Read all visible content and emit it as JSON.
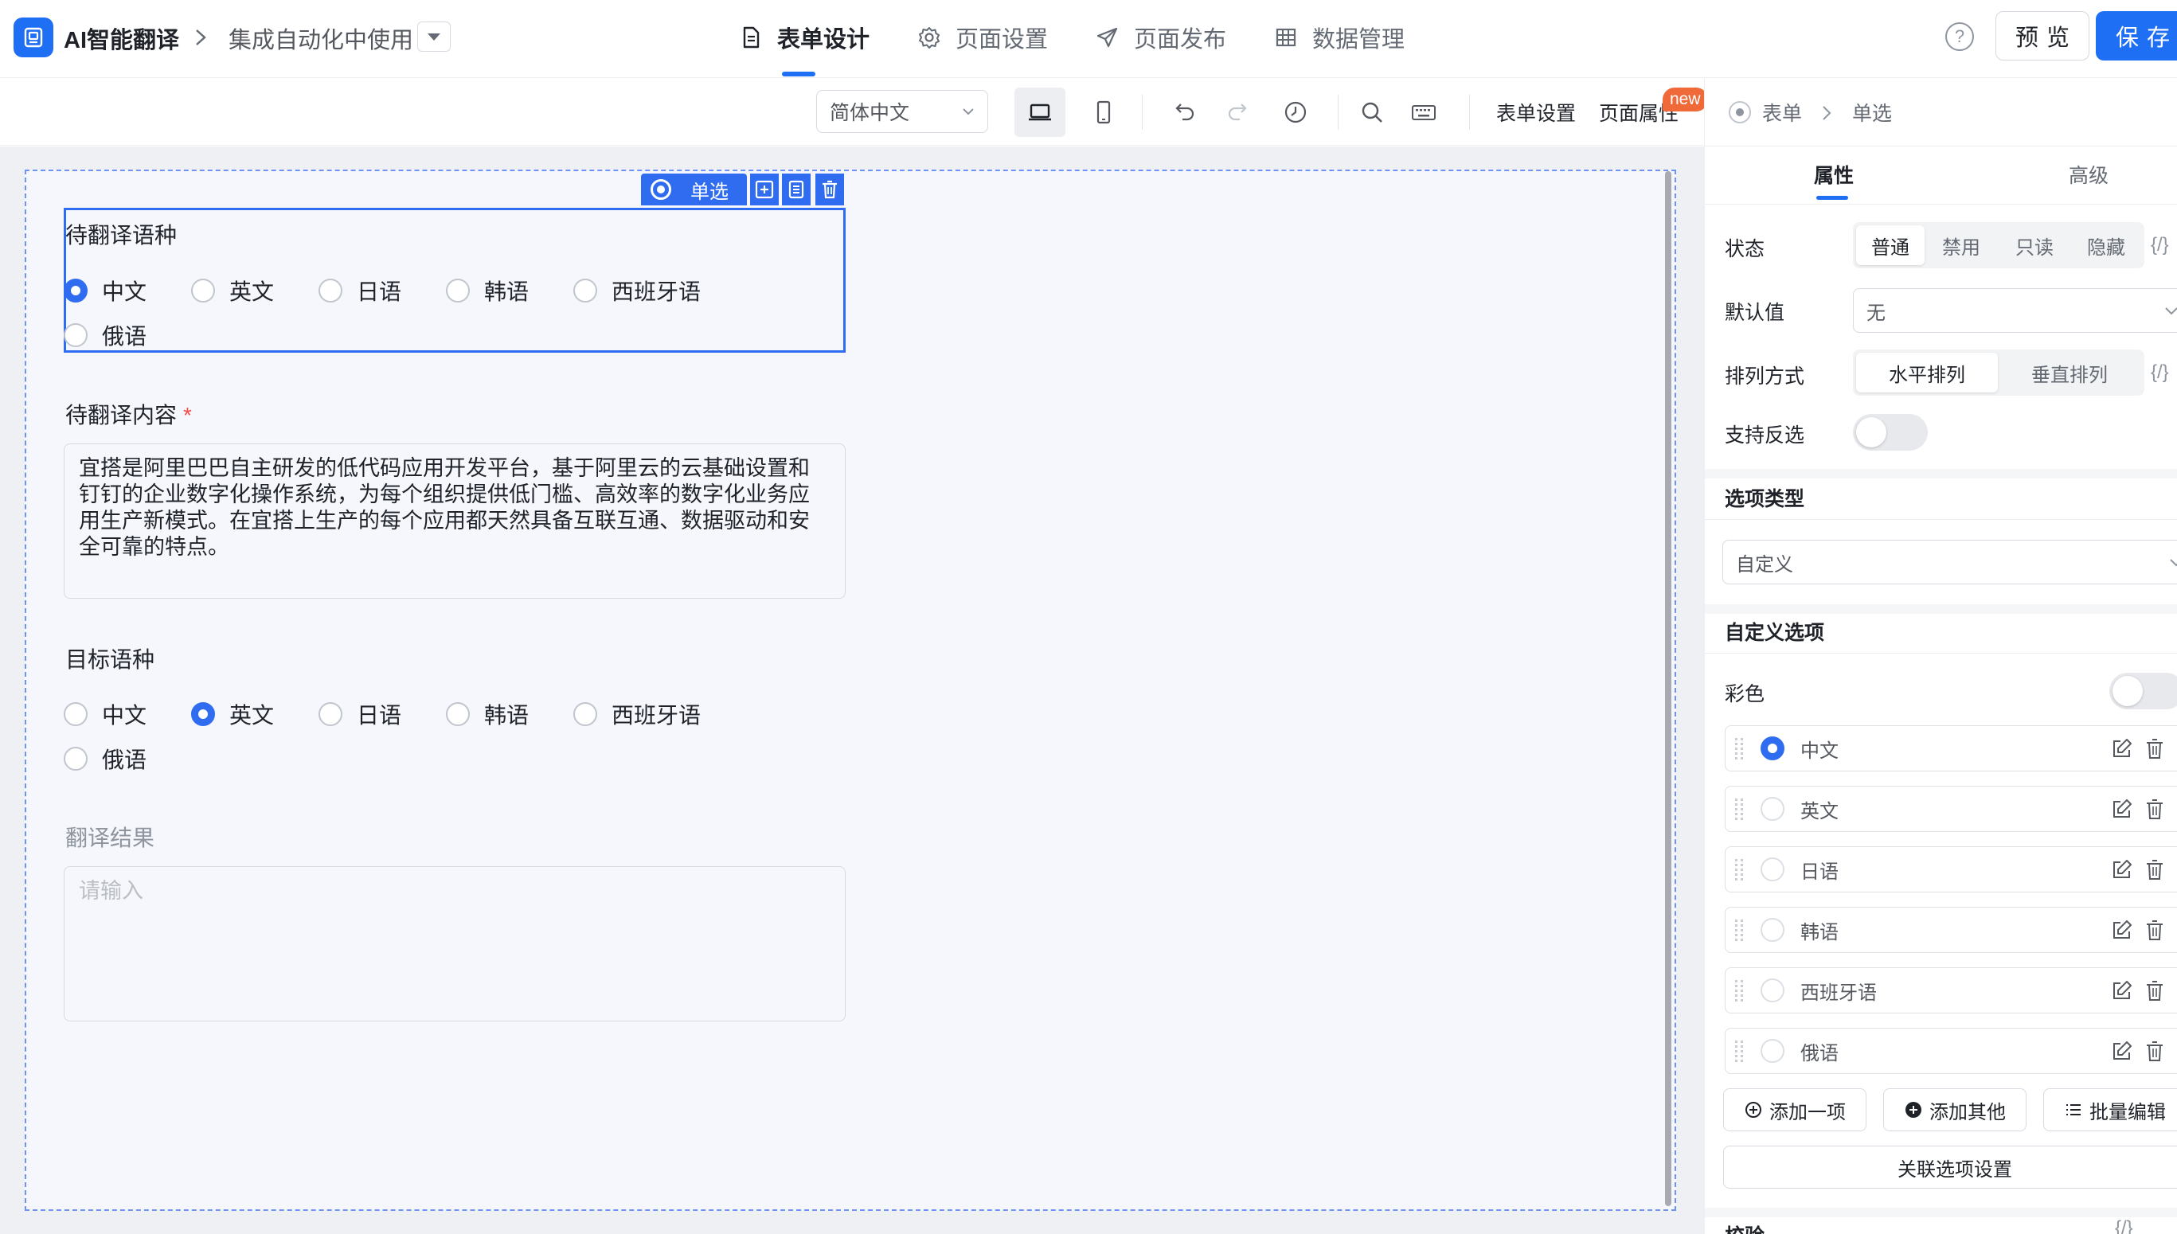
{
  "header": {
    "app_name": "AI智能翻译",
    "page_name": "集成自动化中使用",
    "tabs": [
      {
        "label": "表单设计",
        "icon": "document-icon",
        "active": true
      },
      {
        "label": "页面设置",
        "icon": "gear-icon",
        "active": false
      },
      {
        "label": "页面发布",
        "icon": "send-icon",
        "active": false
      },
      {
        "label": "数据管理",
        "icon": "table-icon",
        "active": false
      }
    ],
    "help_glyph": "?",
    "preview_label": "预览",
    "save_label": "保存",
    "accent_color": "#1f6ff5"
  },
  "toolbar": {
    "language": "简体中文",
    "form_settings_label": "表单设置",
    "page_props_label": "页面属性",
    "new_badge": "new"
  },
  "canvas": {
    "selected_tag": "单选",
    "fields": [
      {
        "label": "待翻译语种",
        "options": [
          "中文",
          "英文",
          "日语",
          "韩语",
          "西班牙语",
          "俄语"
        ],
        "selected": "中文"
      },
      {
        "label": "待翻译内容",
        "required_mark": "*",
        "value": "宜搭是阿里巴巴自主研发的低代码应用开发平台，基于阿里云的云基础设置和钉钉的企业数字化操作系统，为每个组织提供低门槛、高效率的数字化业务应用生产新模式。在宜搭上生产的每个应用都天然具备互联互通、数据驱动和安全可靠的特点。"
      },
      {
        "label": "目标语种",
        "options": [
          "中文",
          "英文",
          "日语",
          "韩语",
          "西班牙语",
          "俄语"
        ],
        "selected": "英文"
      },
      {
        "label": "翻译结果",
        "placeholder": "请输入"
      }
    ]
  },
  "panel": {
    "breadcrumb": [
      "表单",
      "单选"
    ],
    "tabs": [
      "属性",
      "高级"
    ],
    "status": {
      "label": "状态",
      "options": [
        "普通",
        "禁用",
        "只读",
        "隐藏"
      ],
      "selected": "普通",
      "expr": "{/}"
    },
    "default_value": {
      "label": "默认值",
      "value": "无"
    },
    "layout": {
      "label": "排列方式",
      "options": [
        "水平排列",
        "垂直排列"
      ],
      "selected": "水平排列",
      "expr": "{/}"
    },
    "deselect": {
      "label": "支持反选",
      "on": false
    },
    "option_type": {
      "title": "选项类型",
      "value": "自定义"
    },
    "custom_options": {
      "title": "自定义选项",
      "color_label": "彩色",
      "color_on": false,
      "items": [
        {
          "label": "中文",
          "checked": true
        },
        {
          "label": "英文",
          "checked": false
        },
        {
          "label": "日语",
          "checked": false
        },
        {
          "label": "韩语",
          "checked": false
        },
        {
          "label": "西班牙语",
          "checked": false
        },
        {
          "label": "俄语",
          "checked": false
        }
      ],
      "add_one": "添加一项",
      "add_other": "添加其他",
      "batch_edit": "批量编辑",
      "linked_settings": "关联选项设置"
    },
    "validation": {
      "title": "校验",
      "expr": "{/}"
    }
  }
}
